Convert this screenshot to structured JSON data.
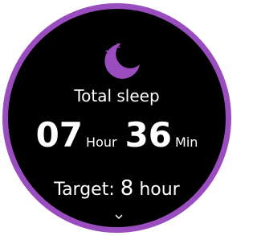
{
  "colors": {
    "accent": "#9a4dbf",
    "background": "#000000",
    "text": "#ffffff"
  },
  "icons": {
    "sleep": "moon-zzz-icon",
    "more": "chevron-down-icon"
  },
  "sleep": {
    "title": "Total sleep",
    "hours": "07",
    "hours_unit": "Hour",
    "minutes": "36",
    "minutes_unit": "Min"
  },
  "target": {
    "label": "Target:",
    "value": "8",
    "unit": "hour"
  }
}
